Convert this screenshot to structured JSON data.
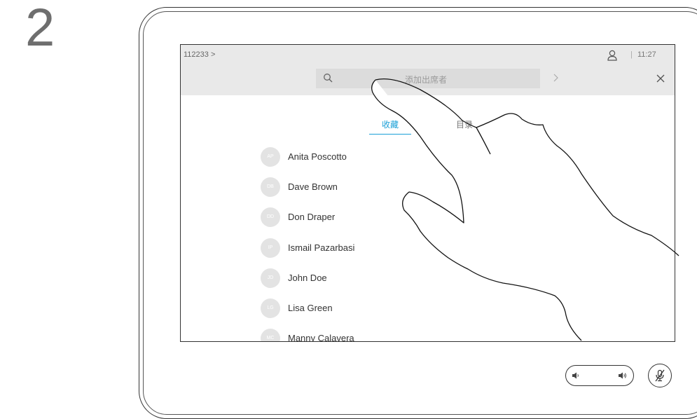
{
  "step_number": "2",
  "topbar": {
    "call_id": "112233 >",
    "separator": "|",
    "time": "11:27"
  },
  "search": {
    "placeholder": "添加出席者"
  },
  "tabs": {
    "favorites": "收藏",
    "directory": "目录"
  },
  "contacts": [
    {
      "initials": "AP",
      "name": "Anita Poscotto"
    },
    {
      "initials": "DB",
      "name": "Dave Brown"
    },
    {
      "initials": "DD",
      "name": "Don Draper"
    },
    {
      "initials": "IP",
      "name": "Ismail Pazarbasi"
    },
    {
      "initials": "JD",
      "name": "John Doe"
    },
    {
      "initials": "LG",
      "name": "Lisa Green"
    },
    {
      "initials": "MC",
      "name": "Manny Calavera"
    }
  ],
  "icons": {
    "user": "user-icon",
    "search": "search-icon",
    "forward": "chevron-right-icon",
    "close": "close-icon",
    "volume_down": "volume-down-icon",
    "volume_up": "volume-up-icon",
    "mute": "microphone-muted-icon",
    "hand": "pointing-hand-illustration"
  },
  "colors": {
    "accent": "#1ba0d7",
    "topbar_bg": "#e9e9e9",
    "search_bg": "#dcdcdc",
    "avatar_bg": "#e3e3e3"
  }
}
